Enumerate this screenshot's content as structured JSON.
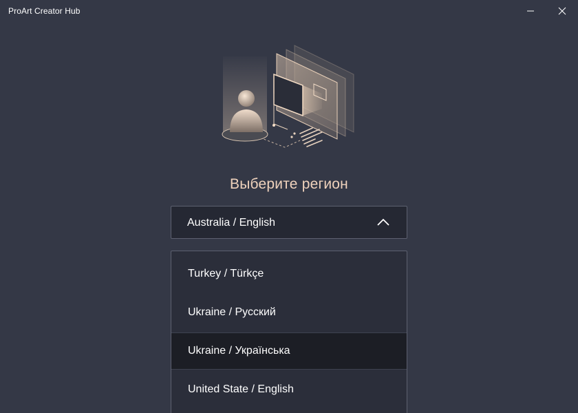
{
  "window": {
    "title": "ProArt Creator Hub",
    "controls": [
      "minimize",
      "close"
    ]
  },
  "hero": {
    "icon": "creator-illustration-icon"
  },
  "region": {
    "heading": "Выберите регион",
    "selected": "Australia / English",
    "expanded": true,
    "options": [
      {
        "label": "Turkey / Türkçe"
      },
      {
        "label": "Ukraine / Русский"
      },
      {
        "label": "Ukraine / Українська",
        "highlighted": true
      },
      {
        "label": "United State / English"
      }
    ]
  },
  "colors": {
    "background": "#343846",
    "heading": "#f0d3bd",
    "field": "#252833",
    "list": "#2b2e3a",
    "highlight": "#1c1e25",
    "border": "#5d6170"
  }
}
